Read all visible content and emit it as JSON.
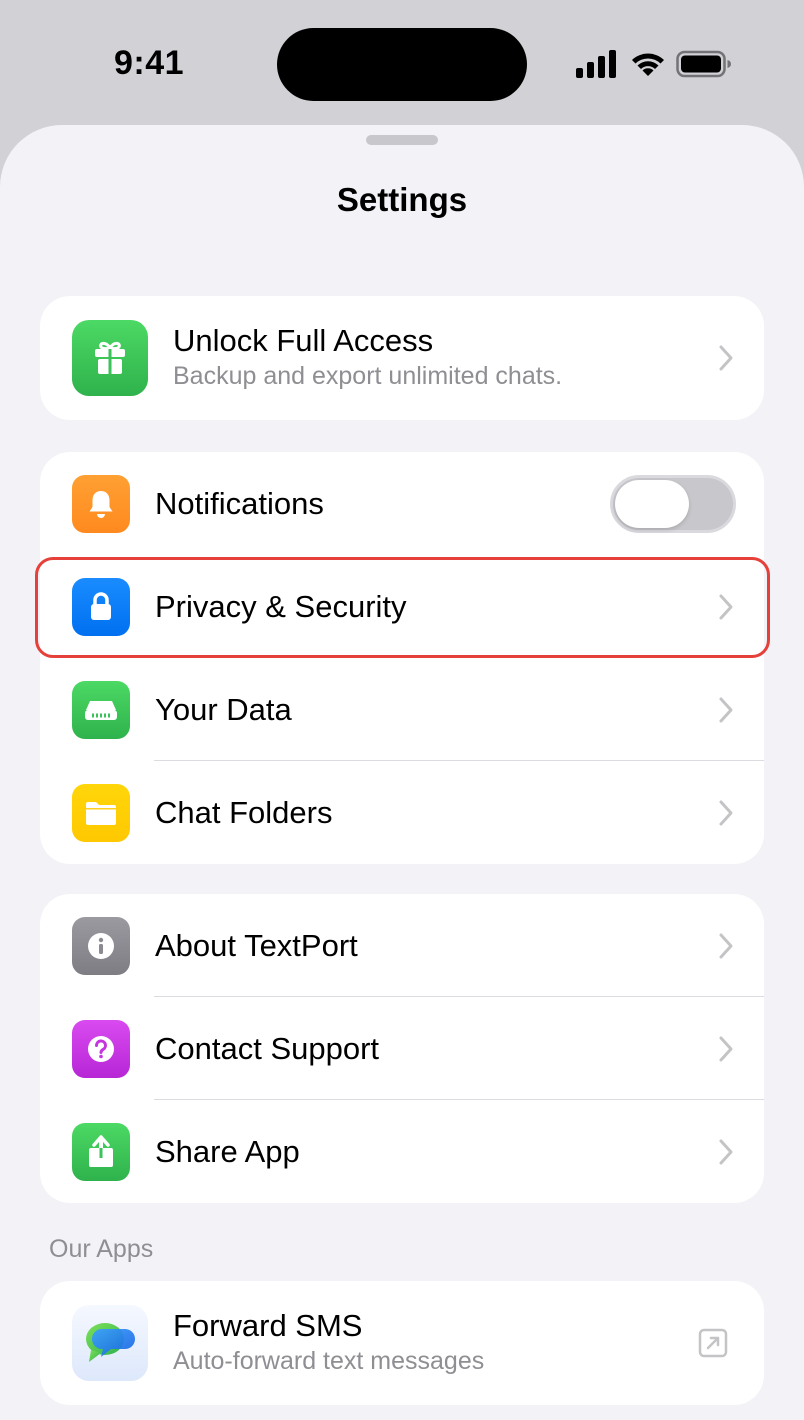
{
  "status_bar": {
    "time": "9:41",
    "icons": [
      "cellular-signal-icon",
      "wifi-icon",
      "battery-icon"
    ]
  },
  "sheet": {
    "title": "Settings"
  },
  "promo": {
    "title": "Unlock Full Access",
    "subtitle": "Backup and export unlimited chats.",
    "icon": "gift-icon",
    "icon_color": "#34c759"
  },
  "general": {
    "items": [
      {
        "label": "Notifications",
        "icon": "bell-icon",
        "icon_color": "#ff9500",
        "control": "toggle",
        "toggle_on": false
      },
      {
        "label": "Privacy & Security",
        "icon": "lock-icon",
        "icon_color": "#007aff",
        "control": "chevron",
        "highlighted": true
      },
      {
        "label": "Your Data",
        "icon": "drive-icon",
        "icon_color": "#34c759",
        "control": "chevron"
      },
      {
        "label": "Chat Folders",
        "icon": "folder-icon",
        "icon_color": "#ffcc00",
        "control": "chevron"
      }
    ]
  },
  "about": {
    "items": [
      {
        "label": "About TextPort",
        "icon": "info-icon",
        "icon_color": "#8e8e93"
      },
      {
        "label": "Contact Support",
        "icon": "question-icon",
        "icon_color": "#cc33e0"
      },
      {
        "label": "Share App",
        "icon": "share-icon",
        "icon_color": "#34c759"
      }
    ]
  },
  "our_apps": {
    "header": "Our Apps",
    "items": [
      {
        "title": "Forward SMS",
        "subtitle": "Auto-forward text messages",
        "icon": "chat-bubble-icon",
        "trailing_icon": "external-link-icon"
      }
    ]
  },
  "colors": {
    "background": "#f2f2f7",
    "highlight_border": "#e5413a",
    "secondary_text": "#8e8e93"
  }
}
